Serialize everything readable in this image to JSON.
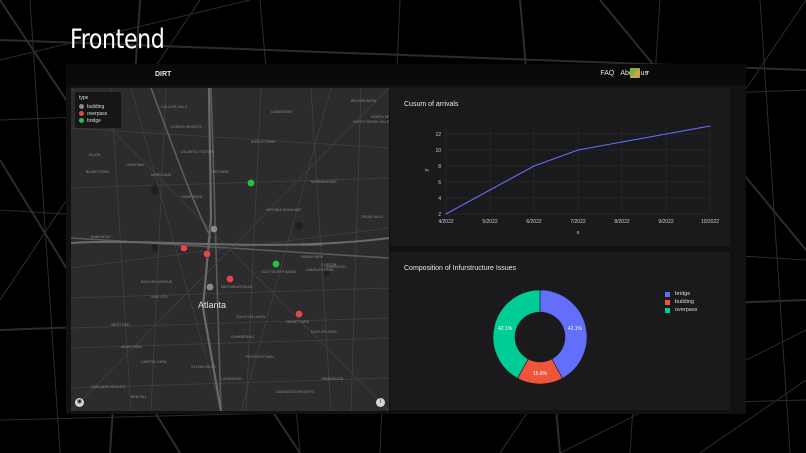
{
  "slide": {
    "title": "Frontend"
  },
  "navbar": {
    "brand": "DIRT",
    "links": [
      "FAQ",
      "About us"
    ],
    "caret": "▾"
  },
  "map": {
    "legend_title": "type",
    "legend": [
      {
        "label": "building",
        "color": "#8b8b8b"
      },
      {
        "label": "overpass",
        "color": "#e04848"
      },
      {
        "label": "bridge",
        "color": "#2bbf4a"
      }
    ],
    "city_label": "Atlanta",
    "place_labels": [
      "ELLEN",
      "CHASTAIN",
      "MORELAND",
      "BANKHEAD",
      "OLD FOURTH WARD",
      "INMAN PARK",
      "GRANT PARK",
      "LAKEWOOD",
      "ORMEWOOD",
      "EDGEWOOD",
      "CANDLER PARK",
      "KIRKWOOD",
      "EAST ATLANTA",
      "PEOPLESTOWN",
      "SUMMERHILL",
      "ENGLISH AVENUE",
      "VINE CITY",
      "HOME PARK",
      "MIDTOWN",
      "ANSLEY PARK",
      "VIRGINIA HIGHLAND",
      "MORNINGSIDE",
      "NORTH DRUID HILLS",
      "DRUID HILLS",
      "CLIFTON",
      "LINDBERGH",
      "BROOKHAVEN",
      "WEST END",
      "ADAIR PARK",
      "CAPITOL VIEW",
      "SYLVAN HILLS",
      "BOLTON",
      "BLANDTOWN",
      "LORING HEIGHTS",
      "COLLIER HILLS",
      "ATLANTIC STATION",
      "MECHANICSVILLE",
      "CASCADE HEIGHTS",
      "BEN HILL",
      "LAKEWOOD HEIGHTS",
      "SOUTH ATLANTA",
      "NORTH DRUID"
    ],
    "places": [
      {
        "name": "building",
        "type": "building"
      },
      {
        "name": "building",
        "type": "building"
      },
      {
        "name": "overpass",
        "type": "overpass"
      },
      {
        "name": "overpass",
        "type": "overpass"
      },
      {
        "name": "overpass",
        "type": "overpass"
      },
      {
        "name": "overpass",
        "type": "overpass"
      },
      {
        "name": "bridge",
        "type": "bridge"
      },
      {
        "name": "bridge",
        "type": "bridge"
      }
    ]
  },
  "chart_data": [
    {
      "type": "line",
      "title": "Cusum of arrivals",
      "xlabel": "x",
      "ylabel": "y",
      "x": [
        "4/2022",
        "5/2022",
        "6/2022",
        "7/2022",
        "8/2022",
        "9/2022",
        "10/2022"
      ],
      "series": [
        {
          "name": "",
          "values": [
            2,
            5,
            8,
            10,
            11,
            12,
            13
          ]
        }
      ],
      "yticks": [
        2,
        4,
        6,
        8,
        10,
        12
      ],
      "ylim": [
        2,
        13
      ],
      "color": "#636efa",
      "grid": true
    },
    {
      "type": "pie",
      "title": "Composition of Infurstructure Issues",
      "labels": [
        "bridge",
        "building",
        "overpass"
      ],
      "values": [
        42.1,
        15.8,
        42.1
      ],
      "value_labels": [
        "42.1%",
        "15.8%",
        "42.1%"
      ],
      "colors": [
        "#636efa",
        "#ef553b",
        "#00cc96"
      ],
      "hole": true,
      "legend_position": "top-right"
    }
  ]
}
